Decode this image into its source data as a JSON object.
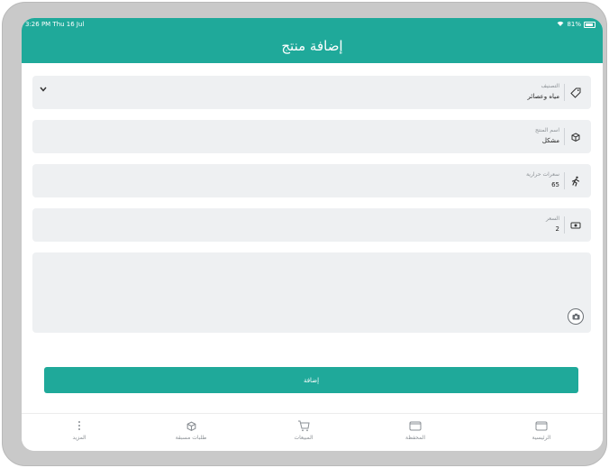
{
  "status_bar": {
    "time": "3:26 PM  Thu 16 Jul",
    "battery": "81%"
  },
  "header": {
    "title": "إضافة منتج"
  },
  "fields": {
    "category": {
      "label": "التصنيف",
      "value": "مياه وعصائر"
    },
    "product_name": {
      "label": "اسم المنتج",
      "value": "مشكل"
    },
    "calories": {
      "label": "سعرات حرارية",
      "value": "65"
    },
    "price": {
      "label": "السعر",
      "value": "2"
    }
  },
  "add_button": {
    "label": "إضافة"
  },
  "tabbar": {
    "home": "الرئيسية",
    "wallet": "المحفظة",
    "sales": "المبيعات",
    "pre_orders": "طلبات مسبقة",
    "more": "المزيد"
  },
  "icons": {
    "category": "tag-icon",
    "product_name": "box-icon",
    "calories": "runner-icon",
    "price": "money-icon",
    "camera": "camera-icon"
  }
}
